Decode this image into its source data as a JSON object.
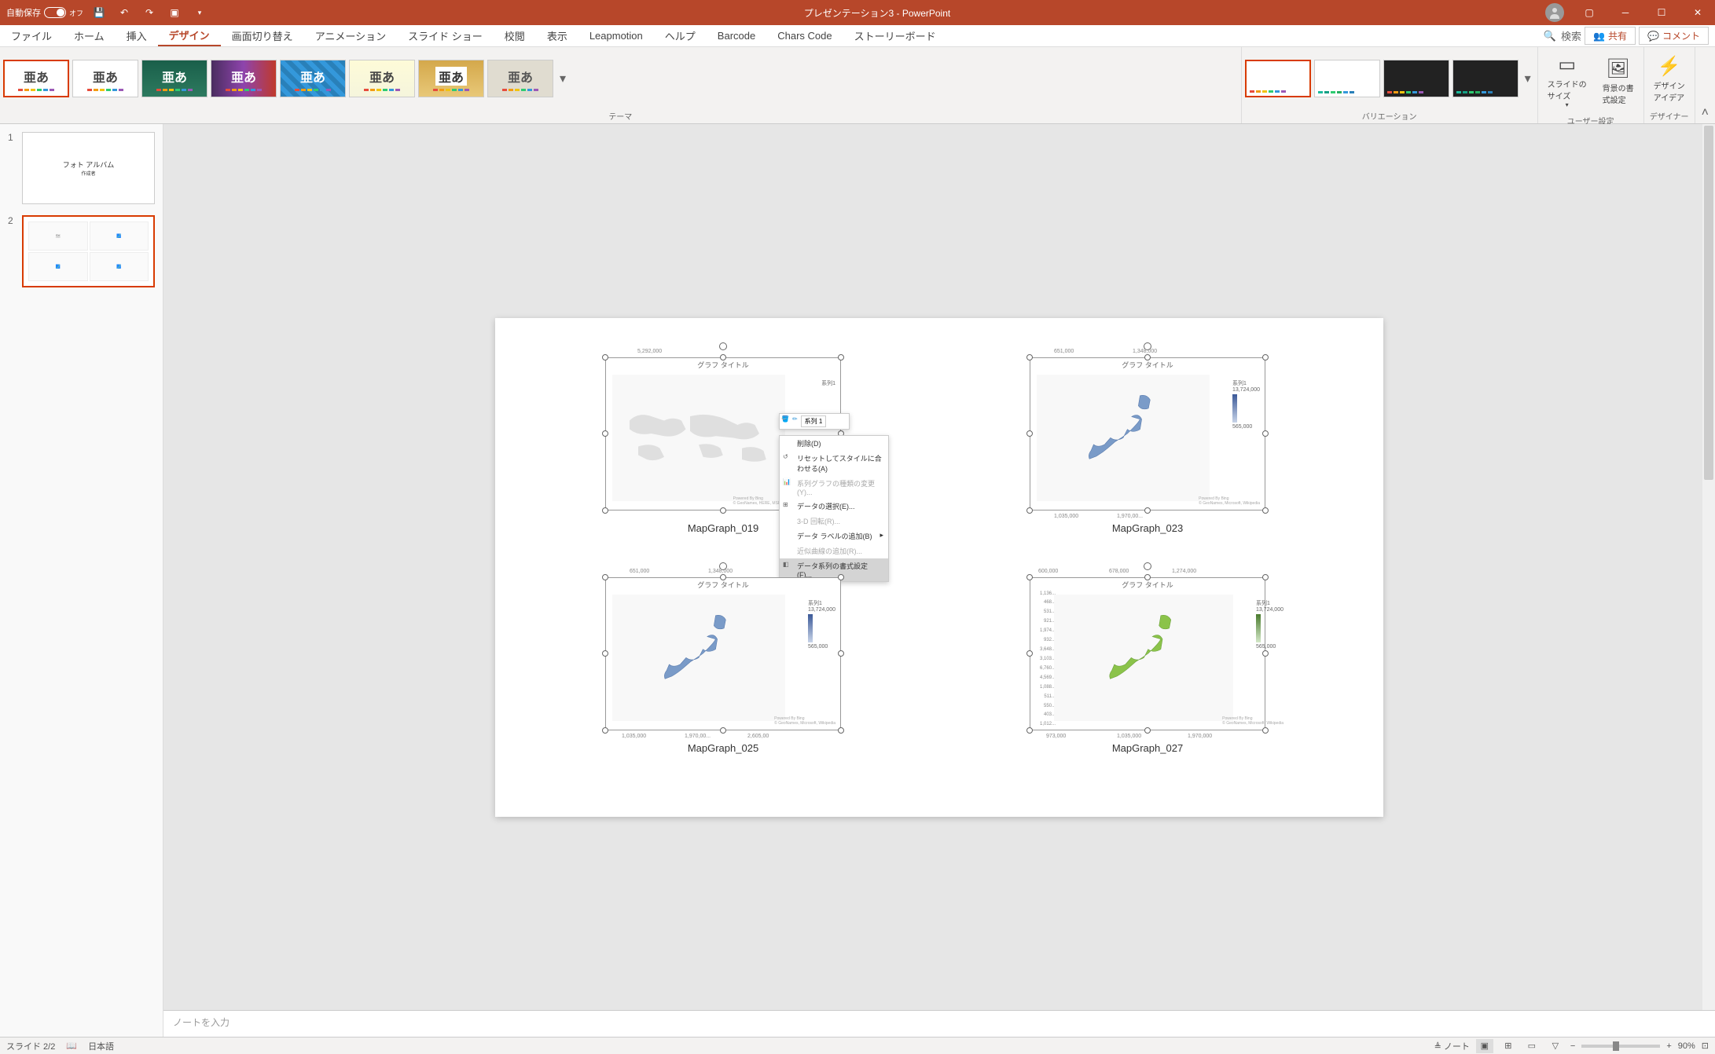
{
  "title_bar": {
    "autosave_label": "自動保存",
    "autosave_state": "オフ",
    "document_title": "プレゼンテーション3 - PowerPoint"
  },
  "ribbon_tabs": [
    "ファイル",
    "ホーム",
    "挿入",
    "デザイン",
    "画面切り替え",
    "アニメーション",
    "スライド ショー",
    "校閲",
    "表示",
    "Leapmotion",
    "ヘルプ",
    "Barcode",
    "Chars Code",
    "ストーリーボード"
  ],
  "active_tab_index": 3,
  "search_placeholder": "検索",
  "share_label": "共有",
  "comment_label": "コメント",
  "ribbon_groups": {
    "themes_label": "テーマ",
    "variations_label": "バリエーション",
    "customize_label": "ユーザー設定",
    "designer_label": "デザイナー",
    "slide_size_label": "スライドの\nサイズ",
    "format_bg_label": "背景の書\n式設定",
    "design_ideas_label": "デザイン\nアイデア"
  },
  "theme_sample_text": "亜あ",
  "slide_panel": {
    "slides": [
      {
        "num": "1",
        "title": "フォト アルバム",
        "subtitle": "作成者"
      },
      {
        "num": "2"
      }
    ],
    "selected_index": 1
  },
  "charts": [
    {
      "id": "c1",
      "caption": "MapGraph_019",
      "title": "グラフ タイトル",
      "legend_name": "系列1",
      "top_value": "5,292,000",
      "attribution": "Powered By Bing\n© GeoNames, HERE, MSFT, Microsoft, NavInfo, Wikipedia",
      "selected": true,
      "map_type": "world"
    },
    {
      "id": "c2",
      "caption": "MapGraph_023",
      "title": "グラフ タイトル",
      "legend_name": "系列1",
      "legend_max": "13,724,000",
      "legend_min": "565,000",
      "x_ticks": [
        "651,000",
        "1,348,000"
      ],
      "bottom_ticks": [
        "1,035,000",
        "1,970,00..."
      ],
      "attribution": "Powered By Bing\n© GeoNames, Microsoft, Wikipedia",
      "selected": true,
      "map_type": "japan_blue"
    },
    {
      "id": "c3",
      "caption": "MapGraph_025",
      "title": "グラフ タイトル",
      "legend_name": "系列1",
      "legend_max": "13,724,000",
      "legend_min": "565,000",
      "x_ticks": [
        "651,000",
        "1,348,000"
      ],
      "bottom_ticks": [
        "1,035,000",
        "1,970,00...",
        "2,605,00"
      ],
      "attribution": "Powered By Bing\n© GeoNames, Microsoft, Wikipedia",
      "selected": true,
      "map_type": "japan_blue"
    },
    {
      "id": "c4",
      "caption": "MapGraph_027",
      "title": "グラフ タイトル",
      "legend_name": "系列1",
      "legend_max": "13,724,000",
      "legend_min": "565,000",
      "x_top_ticks": [
        "600,000",
        "678,000",
        "1,274,000"
      ],
      "y_ticks": [
        "1,136...",
        "468...",
        "531...",
        "921...",
        "1,974...",
        "932...",
        "3,648...",
        "3,103...",
        "6,760...",
        "4,569...",
        "1,088...",
        "511...",
        "550...",
        "403...",
        "1,012..."
      ],
      "x_bottom_ticks": [
        "973,000",
        "1,035,000",
        "1,970,000"
      ],
      "attribution": "Powered By Bing\n© GeoNames, Microsoft, Wikipedia",
      "selected": true,
      "map_type": "japan_green"
    }
  ],
  "mini_toolbar": {
    "fill_label": "塗りつ...",
    "outline_label": "枠線",
    "series_label": "系列 1"
  },
  "context_menu": [
    {
      "label": "削除(D)",
      "disabled": false
    },
    {
      "label": "リセットしてスタイルに合わせる(A)",
      "disabled": false
    },
    {
      "label": "系列グラフの種類の変更(Y)...",
      "disabled": true
    },
    {
      "label": "データの選択(E)...",
      "disabled": false
    },
    {
      "label": "3-D 回転(R)...",
      "disabled": true
    },
    {
      "label": "データ ラベルの追加(B)",
      "disabled": false,
      "has_sub": true
    },
    {
      "label": "近似曲線の追加(R)...",
      "disabled": true
    },
    {
      "label": "データ系列の書式設定(F)...",
      "disabled": false,
      "highlighted": true
    }
  ],
  "notes_placeholder": "ノートを入力",
  "status_bar": {
    "slide_info": "スライド 2/2",
    "language": "日本語",
    "notes_label": "ノート",
    "zoom": "90%"
  }
}
